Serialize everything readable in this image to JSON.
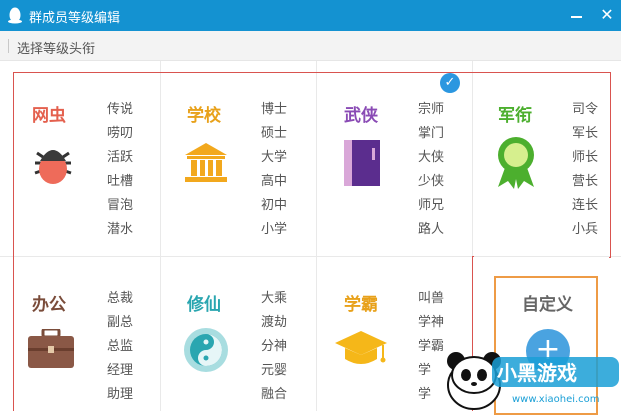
{
  "window": {
    "title": "群成员等级编辑",
    "subtitle": "选择等级头衔",
    "min_icon": "minimize-icon",
    "close_icon": "close-icon",
    "close_glyph": "✕"
  },
  "categories": [
    {
      "name": "网虫",
      "color": "#e4604e",
      "icon": "bug-icon",
      "levels": [
        "传说",
        "唠叨",
        "活跃",
        "吐槽",
        "冒泡",
        "潜水"
      ]
    },
    {
      "name": "学校",
      "color": "#e8a11a",
      "icon": "school-building-icon",
      "levels": [
        "博士",
        "硕士",
        "大学",
        "高中",
        "初中",
        "小学"
      ]
    },
    {
      "name": "武侠",
      "color": "#8a4bb5",
      "icon": "book-icon",
      "selected": true,
      "levels": [
        "宗师",
        "掌门",
        "大侠",
        "少侠",
        "师兄",
        "路人"
      ]
    },
    {
      "name": "军衔",
      "color": "#4caf2e",
      "icon": "medal-icon",
      "levels": [
        "司令",
        "军长",
        "师长",
        "营长",
        "连长",
        "小兵"
      ]
    },
    {
      "name": "办公",
      "color": "#7a4c3a",
      "icon": "briefcase-icon",
      "levels": [
        "总裁",
        "副总",
        "总监",
        "经理",
        "助理"
      ]
    },
    {
      "name": "修仙",
      "color": "#2aa6b0",
      "icon": "yin-yang-icon",
      "levels": [
        "大乘",
        "渡劫",
        "分神",
        "元婴",
        "融合"
      ]
    },
    {
      "name": "学霸",
      "color": "#e8a11a",
      "icon": "graduation-cap-icon",
      "levels": [
        "叫兽",
        "学神",
        "学霸",
        "学",
        "学"
      ]
    }
  ],
  "custom": {
    "label": "自定义",
    "plus_glyph": "+",
    "icon": "add-icon"
  },
  "checkmark": "✓",
  "watermark": {
    "url": "www.xiaohei.com",
    "text": "小黑游戏"
  }
}
